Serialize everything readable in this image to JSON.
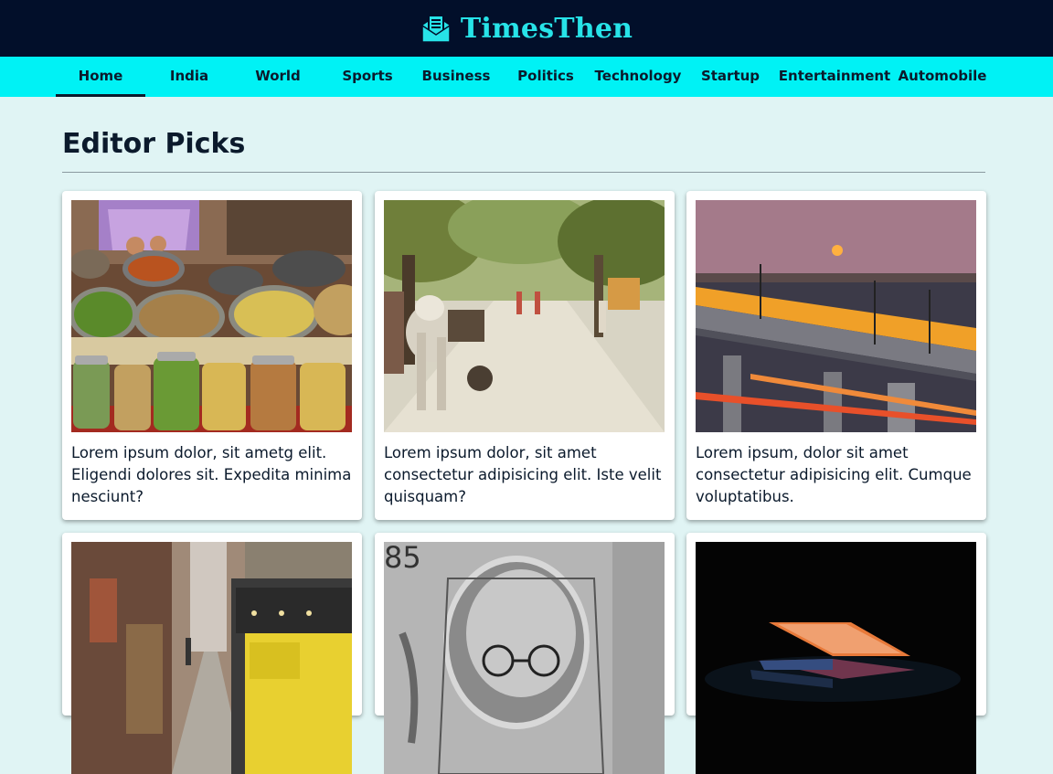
{
  "header": {
    "site_name": "TimesThen",
    "logo_icon": "newspaper-envelope-icon",
    "bg_color": "#020f2a",
    "accent_color": "#27e3e8"
  },
  "nav": {
    "bg_color": "#00f2f5",
    "active": "Home",
    "items": [
      "Home",
      "India",
      "World",
      "Sports",
      "Business",
      "Politics",
      "Technology",
      "Startup",
      "Entertainment",
      "Automobile"
    ]
  },
  "section": {
    "title": "Editor Picks"
  },
  "cards": [
    {
      "text": "Lorem ipsum dolor, sit ametg elit. Eligendi dolores sit. Expedita minima nesciunt?",
      "image": "spice-market-photo"
    },
    {
      "text": "Lorem ipsum dolor, sit amet consectetur adipisicing elit. Iste velit quisquam?",
      "image": "ox-cart-road-photo"
    },
    {
      "text": "Lorem ipsum, dolor sit amet consectetur adipisicing elit. Cumque voluptatibus.",
      "image": "night-train-bridge-photo"
    },
    {
      "text": "",
      "image": "narrow-street-rickshaw-photo"
    },
    {
      "text": "",
      "image": "banknote-portrait-photo"
    },
    {
      "text": "",
      "image": "laptop-dark-photo"
    }
  ]
}
